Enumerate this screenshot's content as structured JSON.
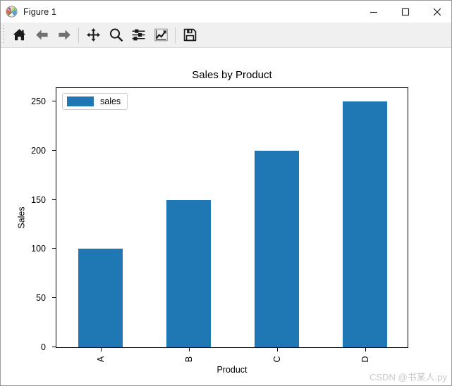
{
  "window": {
    "title": "Figure 1",
    "icon": "matplotlib-logo-icon",
    "controls": {
      "minimize": "minimize-icon",
      "maximize": "maximize-icon",
      "close": "close-icon"
    }
  },
  "toolbar": {
    "buttons": [
      {
        "name": "home",
        "icon": "home-icon",
        "tooltip": "Reset original view"
      },
      {
        "name": "back",
        "icon": "arrow-left-icon",
        "tooltip": "Back to previous view"
      },
      {
        "name": "forward",
        "icon": "arrow-right-icon",
        "tooltip": "Forward to next view"
      },
      {
        "name": "pan",
        "icon": "move-icon",
        "tooltip": "Pan axes with left mouse, zoom with right"
      },
      {
        "name": "zoom",
        "icon": "magnifier-icon",
        "tooltip": "Zoom to rectangle"
      },
      {
        "name": "subplots",
        "icon": "sliders-icon",
        "tooltip": "Configure subplots"
      },
      {
        "name": "customize",
        "icon": "chart-line-icon",
        "tooltip": "Edit axis, curve and image parameters"
      },
      {
        "name": "save",
        "icon": "floppy-disk-icon",
        "tooltip": "Save the figure"
      }
    ]
  },
  "chart_data": {
    "type": "bar",
    "title": "Sales by Product",
    "xlabel": "Product",
    "ylabel": "Sales",
    "categories": [
      "A",
      "B",
      "C",
      "D"
    ],
    "values": [
      100,
      150,
      200,
      250
    ],
    "series": [
      {
        "name": "sales",
        "values": [
          100,
          150,
          200,
          250
        ],
        "color": "#1f77b4"
      }
    ],
    "legend": {
      "position": "upper left",
      "entries": [
        {
          "label": "sales",
          "color": "#1f77b4"
        }
      ]
    },
    "ylim": [
      0,
      265
    ],
    "yticks": [
      0,
      50,
      100,
      150,
      200,
      250
    ],
    "ytick_labels": [
      "0",
      "50",
      "100",
      "150",
      "200",
      "250"
    ],
    "xtick_labels": [
      "A",
      "B",
      "C",
      "D"
    ],
    "xtick_rotation": 90,
    "grid": false,
    "bar_color": "#1f77b4",
    "bar_width": 0.5
  },
  "watermark": {
    "text": "CSDN @书某人.py"
  },
  "colors": {
    "accent": "#1f77b4",
    "toolbar_bg": "#f0f0f0",
    "figure_bg": "#ffffff",
    "axis": "#000000",
    "watermark": "#c9c9c9"
  }
}
